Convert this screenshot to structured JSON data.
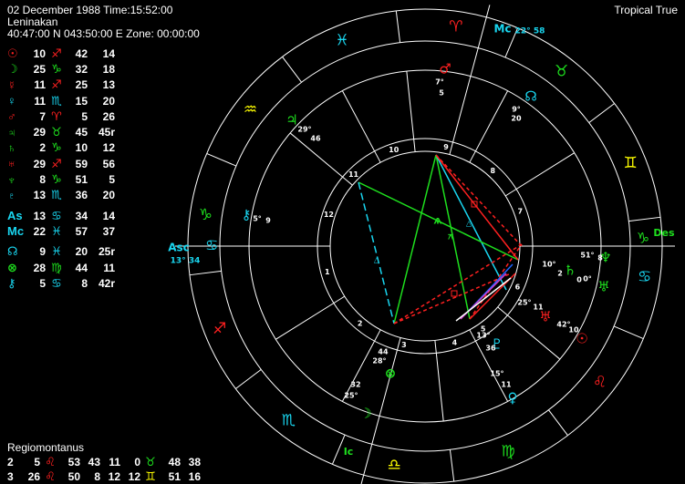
{
  "header": {
    "date_line": "02 December 1988 Time:15:52:00",
    "place_line": "Leninakan",
    "coords_line": "40:47:00 N 043:50:00 E Zone: 00:00:00",
    "mode_label": "Tropical True"
  },
  "planets": [
    {
      "glyph": "☉",
      "glyph_color": "#ff2020",
      "deg": "10",
      "sign": "♐",
      "sign_color": "#ff2020",
      "min": "42",
      "sec": "14"
    },
    {
      "glyph": "☽",
      "glyph_color": "#1ee01e",
      "deg": "25",
      "sign": "♑",
      "sign_color": "#1ee01e",
      "min": "32",
      "sec": "18"
    },
    {
      "glyph": "☿",
      "glyph_color": "#ff2020",
      "deg": "11",
      "sign": "♐",
      "sign_color": "#ff2020",
      "min": "25",
      "sec": "13"
    },
    {
      "glyph": "♀",
      "glyph_color": "#19d6f0",
      "deg": "11",
      "sign": "♏",
      "sign_color": "#19d6f0",
      "min": "15",
      "sec": "20"
    },
    {
      "glyph": "♂",
      "glyph_color": "#ff2020",
      "deg": "7",
      "sign": "♈",
      "sign_color": "#ff2020",
      "min": "5",
      "sec": "26"
    },
    {
      "glyph": "♃",
      "glyph_color": "#1ee01e",
      "deg": "29",
      "sign": "♉",
      "sign_color": "#1ee01e",
      "min": "45",
      "sec": "45r"
    },
    {
      "glyph": "♄",
      "glyph_color": "#1ee01e",
      "deg": "2",
      "sign": "♑",
      "sign_color": "#1ee01e",
      "min": "10",
      "sec": "12"
    },
    {
      "glyph": "♅",
      "glyph_color": "#ff2020",
      "deg": "29",
      "sign": "♐",
      "sign_color": "#ff2020",
      "min": "59",
      "sec": "56"
    },
    {
      "glyph": "♆",
      "glyph_color": "#1ee01e",
      "deg": "8",
      "sign": "♑",
      "sign_color": "#1ee01e",
      "min": "51",
      "sec": "5"
    },
    {
      "glyph": "♇",
      "glyph_color": "#19d6f0",
      "deg": "13",
      "sign": "♏",
      "sign_color": "#19d6f0",
      "min": "36",
      "sec": "20"
    },
    {
      "glyph": "As",
      "glyph_color": "#19d6f0",
      "deg": "13",
      "sign": "♋",
      "sign_color": "#19d6f0",
      "min": "34",
      "sec": "14"
    },
    {
      "glyph": "Mc",
      "glyph_color": "#19d6f0",
      "deg": "22",
      "sign": "♓",
      "sign_color": "#19d6f0",
      "min": "57",
      "sec": "37"
    },
    {
      "glyph": "☊",
      "glyph_color": "#19d6f0",
      "deg": "9",
      "sign": "♓",
      "sign_color": "#19d6f0",
      "min": "20",
      "sec": "25r"
    },
    {
      "glyph": "⊗",
      "glyph_color": "#1ee01e",
      "deg": "28",
      "sign": "♍",
      "sign_color": "#1ee01e",
      "min": "44",
      "sec": "11"
    },
    {
      "glyph": "⚷",
      "glyph_color": "#19d6f0",
      "deg": "5",
      "sign": "♋",
      "sign_color": "#19d6f0",
      "min": "8",
      "sec": "42r"
    }
  ],
  "houses": {
    "system_label": "Regiomontanus",
    "rows": [
      {
        "n1": "2",
        "v1": "5",
        "s1": "♌",
        "s1_color": "#ff2020",
        "v2": "53",
        "v3": "43",
        "v4": "11",
        "v5": "0",
        "s2": "♉",
        "s2_color": "#1ee01e",
        "v6": "48",
        "v7": "38"
      },
      {
        "n1": "3",
        "v1": "26",
        "s1": "♌",
        "s1_color": "#ff2020",
        "v2": "50",
        "v3": "8",
        "v4": "12",
        "v5": "12",
        "s2": "♊",
        "s2_color": "#ffff00",
        "v6": "51",
        "v7": "16"
      }
    ]
  },
  "wheel": {
    "zodiac_signs": [
      {
        "glyph": "♈",
        "color": "#ff2020"
      },
      {
        "glyph": "♓",
        "color": "#19d6f0"
      },
      {
        "glyph": "♒",
        "color": "#ffff00"
      },
      {
        "glyph": "♑",
        "color": "#1ee01e"
      },
      {
        "glyph": "♐",
        "color": "#ff2020"
      },
      {
        "glyph": "♏",
        "color": "#19d6f0"
      },
      {
        "glyph": "♎",
        "color": "#ffff00"
      },
      {
        "glyph": "♍",
        "color": "#1ee01e"
      },
      {
        "glyph": "♌",
        "color": "#ff2020"
      },
      {
        "glyph": "♋",
        "color": "#19d6f0"
      },
      {
        "glyph": "♊",
        "color": "#ffff00"
      },
      {
        "glyph": "♉",
        "color": "#1ee01e"
      }
    ],
    "angles": {
      "mc_label": "Mc",
      "mc_deg": "22",
      "mc_min": "58",
      "asc_label": "Asc",
      "asc_deg": "13",
      "asc_min": "34",
      "des_label": "Des",
      "ic_label": "Ic"
    },
    "house_numbers": [
      "1",
      "2",
      "3",
      "4",
      "5",
      "6",
      "7",
      "8",
      "9",
      "10",
      "11",
      "12"
    ],
    "placed": [
      {
        "glyph": "♂",
        "color": "#ff2020",
        "deg": "7",
        "min": "5"
      },
      {
        "glyph": "☊",
        "color": "#19d6f0",
        "deg": "9",
        "min": "20"
      },
      {
        "glyph": "♃",
        "color": "#1ee01e",
        "deg": "29",
        "min": "46"
      },
      {
        "glyph": "⚷",
        "color": "#19d6f0",
        "deg": "5",
        "min": "9"
      },
      {
        "glyph": "♆",
        "color": "#1ee01e",
        "deg": "51",
        "min": "8"
      },
      {
        "glyph": "♄",
        "color": "#1ee01e",
        "deg": "10",
        "min": "2"
      },
      {
        "glyph": "♅",
        "color": "#1ee01e",
        "deg": "0",
        "min": "0"
      },
      {
        "glyph": "♅",
        "color": "#ff2020",
        "deg": "25",
        "min": "11"
      },
      {
        "glyph": "☉",
        "color": "#ff2020",
        "deg": "42",
        "min": "10"
      },
      {
        "glyph": "♇",
        "color": "#19d6f0",
        "deg": "13",
        "min": "36"
      },
      {
        "glyph": "♀",
        "color": "#19d6f0",
        "deg": "15",
        "min": "11"
      },
      {
        "glyph": "⊗",
        "color": "#1ee01e",
        "deg": "28",
        "min": "44"
      },
      {
        "glyph": "☽",
        "color": "#1ee01e",
        "deg": "25",
        "min": "32"
      }
    ]
  }
}
